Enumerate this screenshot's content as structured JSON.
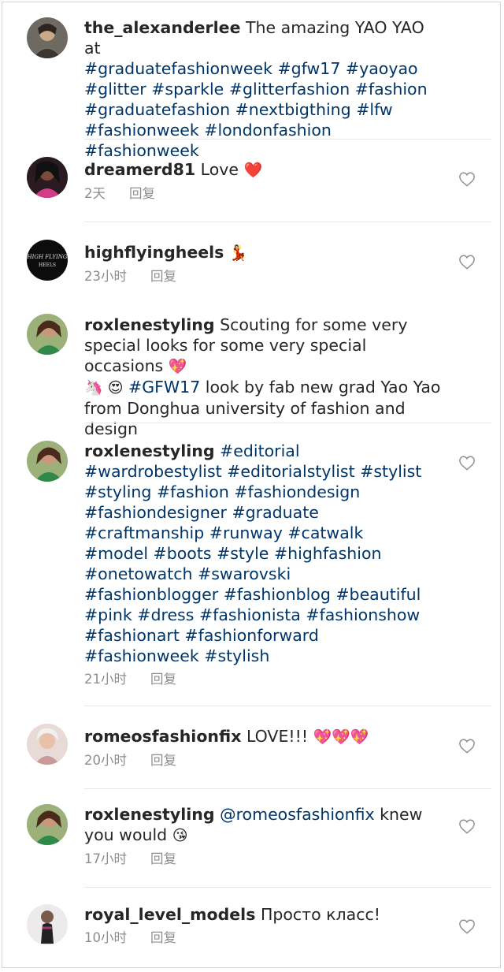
{
  "colors": {
    "hashtag": "#003569",
    "meta": "#8e8e8e",
    "divider": "#e6e6e6"
  },
  "caption": {
    "username": "the_alexanderlee",
    "text": "The amazing YAO YAO at",
    "tags": [
      "#graduatefashionweek",
      "#gfw17",
      "#yaoyao",
      "#glitter",
      "#sparkle",
      "#glitterfashion",
      "#fashion",
      "#graduatefashion",
      "#nextbigthing",
      "#lfw",
      "#fashionweek",
      "#londonfashion",
      "#fashionweek"
    ]
  },
  "comments": [
    {
      "username": "dreamerd81",
      "text": "Love",
      "emoji": "❤️",
      "time": "2天",
      "reply": "回复",
      "icon": "heart-outline-icon"
    },
    {
      "username": "highflyingheels",
      "text": "",
      "emoji": "💃",
      "time": "23小时",
      "reply": "回复",
      "icon": "heart-outline-icon"
    },
    {
      "username": "roxlenestyling",
      "text": "Scouting for some very special looks for some very special occasions",
      "emoji": "💖",
      "emoji2": "🦄 😍",
      "hashtag": "#GFW17",
      "text2": "look by fab new grad Yao Yao from Donghua university of fashion and design"
    },
    {
      "username": "roxlenestyling",
      "tags": [
        "#editorial",
        "#wardrobestylist",
        "#editorialstylist",
        "#stylist",
        "#styling",
        "#fashion",
        "#fashiondesign",
        "#fashiondesigner",
        "#graduate",
        "#craftmanship",
        "#runway",
        "#catwalk",
        "#model",
        "#boots",
        "#style",
        "#highfashion",
        "#onetowatch",
        "#swarovski",
        "#fashionblogger",
        "#fashionblog",
        "#beautiful",
        "#pink",
        "#dress",
        "#fashionista",
        "#fashionshow",
        "#fashionart",
        "#fashionforward",
        "#fashionweek",
        "#stylish"
      ],
      "time": "21小时",
      "reply": "回复",
      "icon": "heart-outline-icon"
    },
    {
      "username": "romeosfashionfix",
      "text": "LOVE!!!",
      "emoji": "💖💖💖",
      "time": "20小时",
      "reply": "回复",
      "icon": "heart-outline-icon"
    },
    {
      "username": "roxlenestyling",
      "mention": "@romeosfashionfix",
      "text": "knew",
      "text2": "you would",
      "emoji": "😘",
      "time": "17小时",
      "reply": "回复",
      "icon": "heart-outline-icon"
    },
    {
      "username": "royal_level_models",
      "text": "Просто класс!",
      "time": "10小时",
      "reply": "回复",
      "icon": "heart-outline-icon"
    }
  ]
}
